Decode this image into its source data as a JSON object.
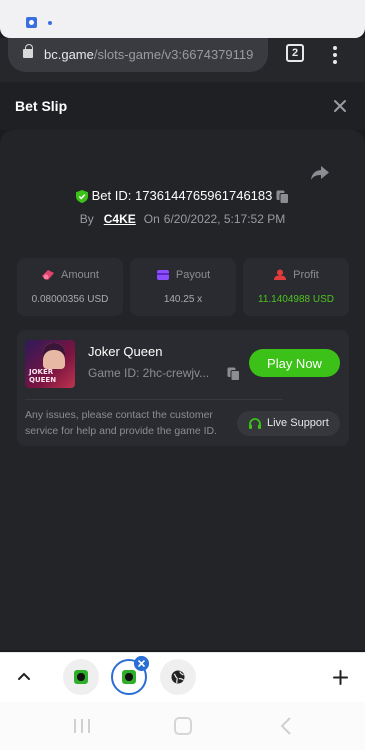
{
  "browser": {
    "url_domain": "bc.game",
    "url_path": "/slots-game/v3:6674379119",
    "tabs_count": "2"
  },
  "page": {
    "title": "Bet Slip"
  },
  "bet": {
    "id_label": "Bet ID:",
    "id_value": "1736144765961746183",
    "by_label": "By",
    "user": "C4KE",
    "on_label": "On",
    "date": "6/20/2022, 5:17:52 PM"
  },
  "stats": {
    "amount_label": "Amount",
    "amount_value": "0.08000356 USD",
    "payout_label": "Payout",
    "payout_value": "140.25 x",
    "profit_label": "Profit",
    "profit_value": "11.1404988 USD"
  },
  "game": {
    "name": "Joker Queen",
    "id_text": "Game ID: 2hc-crewjv...",
    "thumb_line1": "JOKER",
    "thumb_line2": "QUEEN",
    "play_label": "Play Now",
    "support_text": "Any issues, please contact the customer service for help and provide the game ID.",
    "live_support_label": "Live Support"
  },
  "colors": {
    "accent_green": "#3bc117",
    "profit_green": "#4dc31f",
    "background": "#1b1c20"
  }
}
